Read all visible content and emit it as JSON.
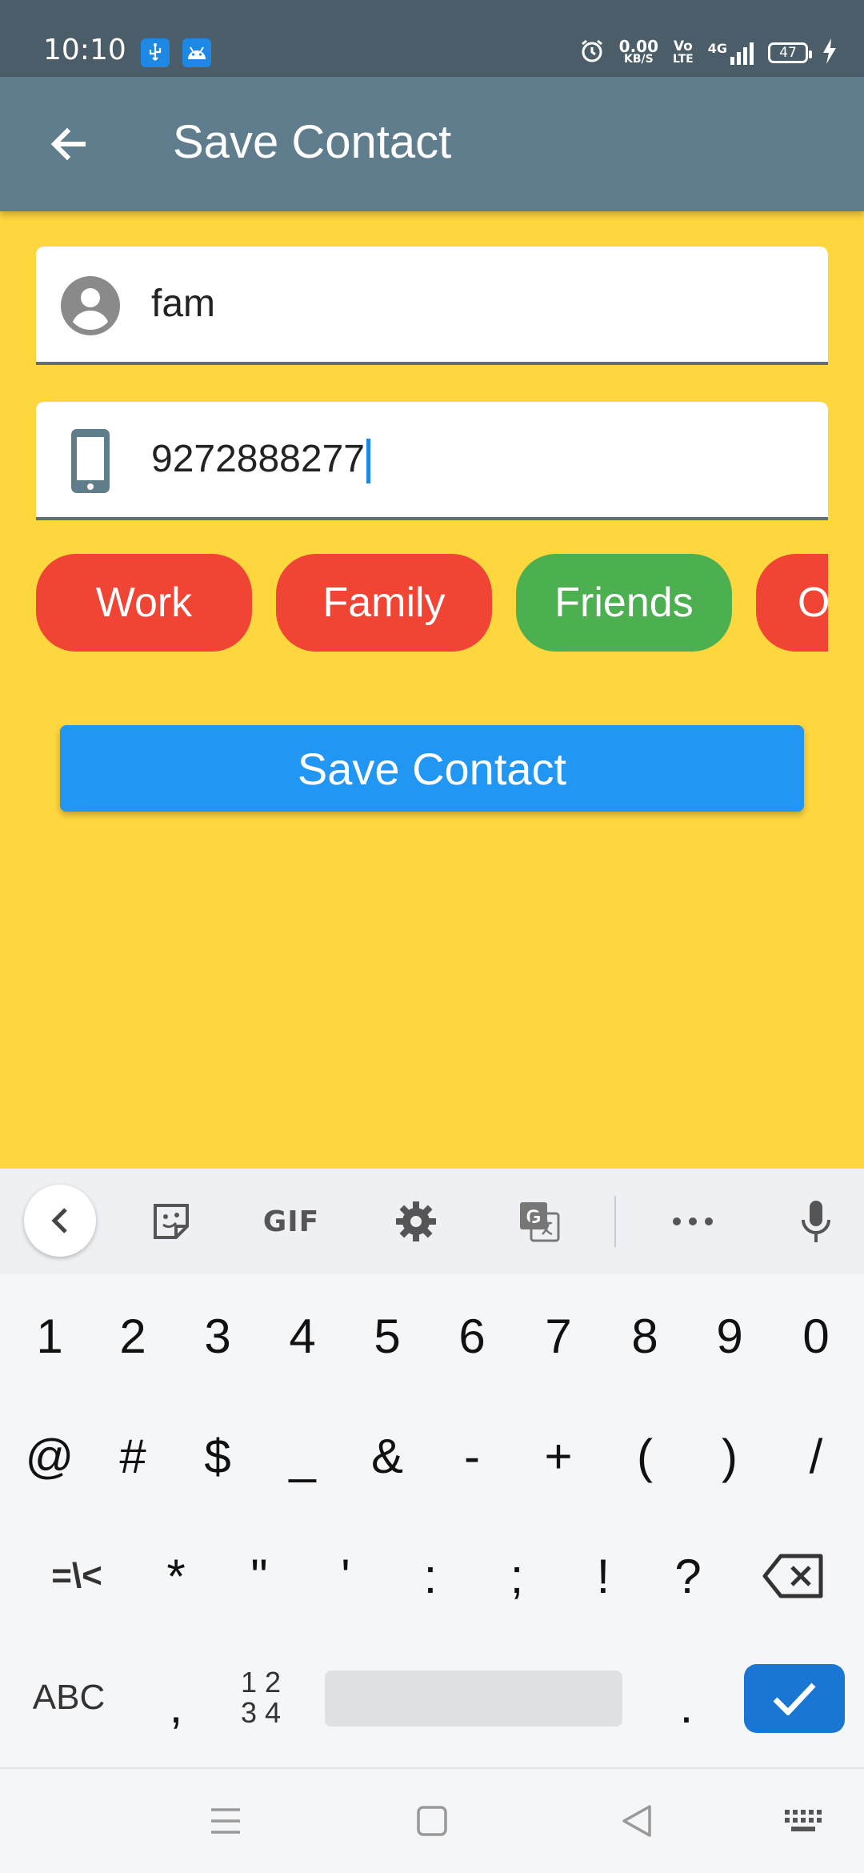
{
  "status_bar": {
    "time": "10:10",
    "net_speed_value": "0.00",
    "net_speed_unit": "KB/S",
    "volte_top": "Vo",
    "volte_bottom": "LTE",
    "network": "4G",
    "battery": "47",
    "icons": [
      "usb-icon",
      "android-icon",
      "alarm-icon",
      "signal-icon",
      "battery-icon",
      "charging-icon"
    ]
  },
  "app_bar": {
    "title": "Save Contact",
    "back_icon": "arrow-left-icon"
  },
  "form": {
    "name_value": "fam",
    "phone_value": "9272888277",
    "name_icon": "account-circle-icon",
    "phone_icon": "smartphone-icon"
  },
  "chips": [
    {
      "label": "Work",
      "color": "#F04434"
    },
    {
      "label": "Family",
      "color": "#F04434"
    },
    {
      "label": "Friends",
      "color": "#4CAF50"
    },
    {
      "label": "O",
      "color": "#F04434"
    }
  ],
  "save_button": {
    "label": "Save Contact",
    "color": "#2196F3"
  },
  "keyboard": {
    "toolbar": {
      "gif_label": "GIF",
      "items": [
        "back-icon",
        "sticker-icon",
        "gif-button",
        "settings-icon",
        "translate-icon",
        "more-icon",
        "mic-icon"
      ]
    },
    "row1": [
      "1",
      "2",
      "3",
      "4",
      "5",
      "6",
      "7",
      "8",
      "9",
      "0"
    ],
    "row2": [
      "@",
      "#",
      "$",
      "_",
      "&",
      "-",
      "+",
      "(",
      ")",
      "/"
    ],
    "row3": [
      "=\\<",
      "*",
      "\"",
      "'",
      ":",
      ";",
      "!",
      "?"
    ],
    "row4": {
      "abc": "ABC",
      "comma": ",",
      "numpad_top": "1 2",
      "numpad_bottom": "3 4",
      "period": "."
    }
  },
  "colors": {
    "background": "#FED63E",
    "app_bar": "#5F7D8C",
    "status_bar": "#4A5D68",
    "accent": "#1E88E5"
  }
}
